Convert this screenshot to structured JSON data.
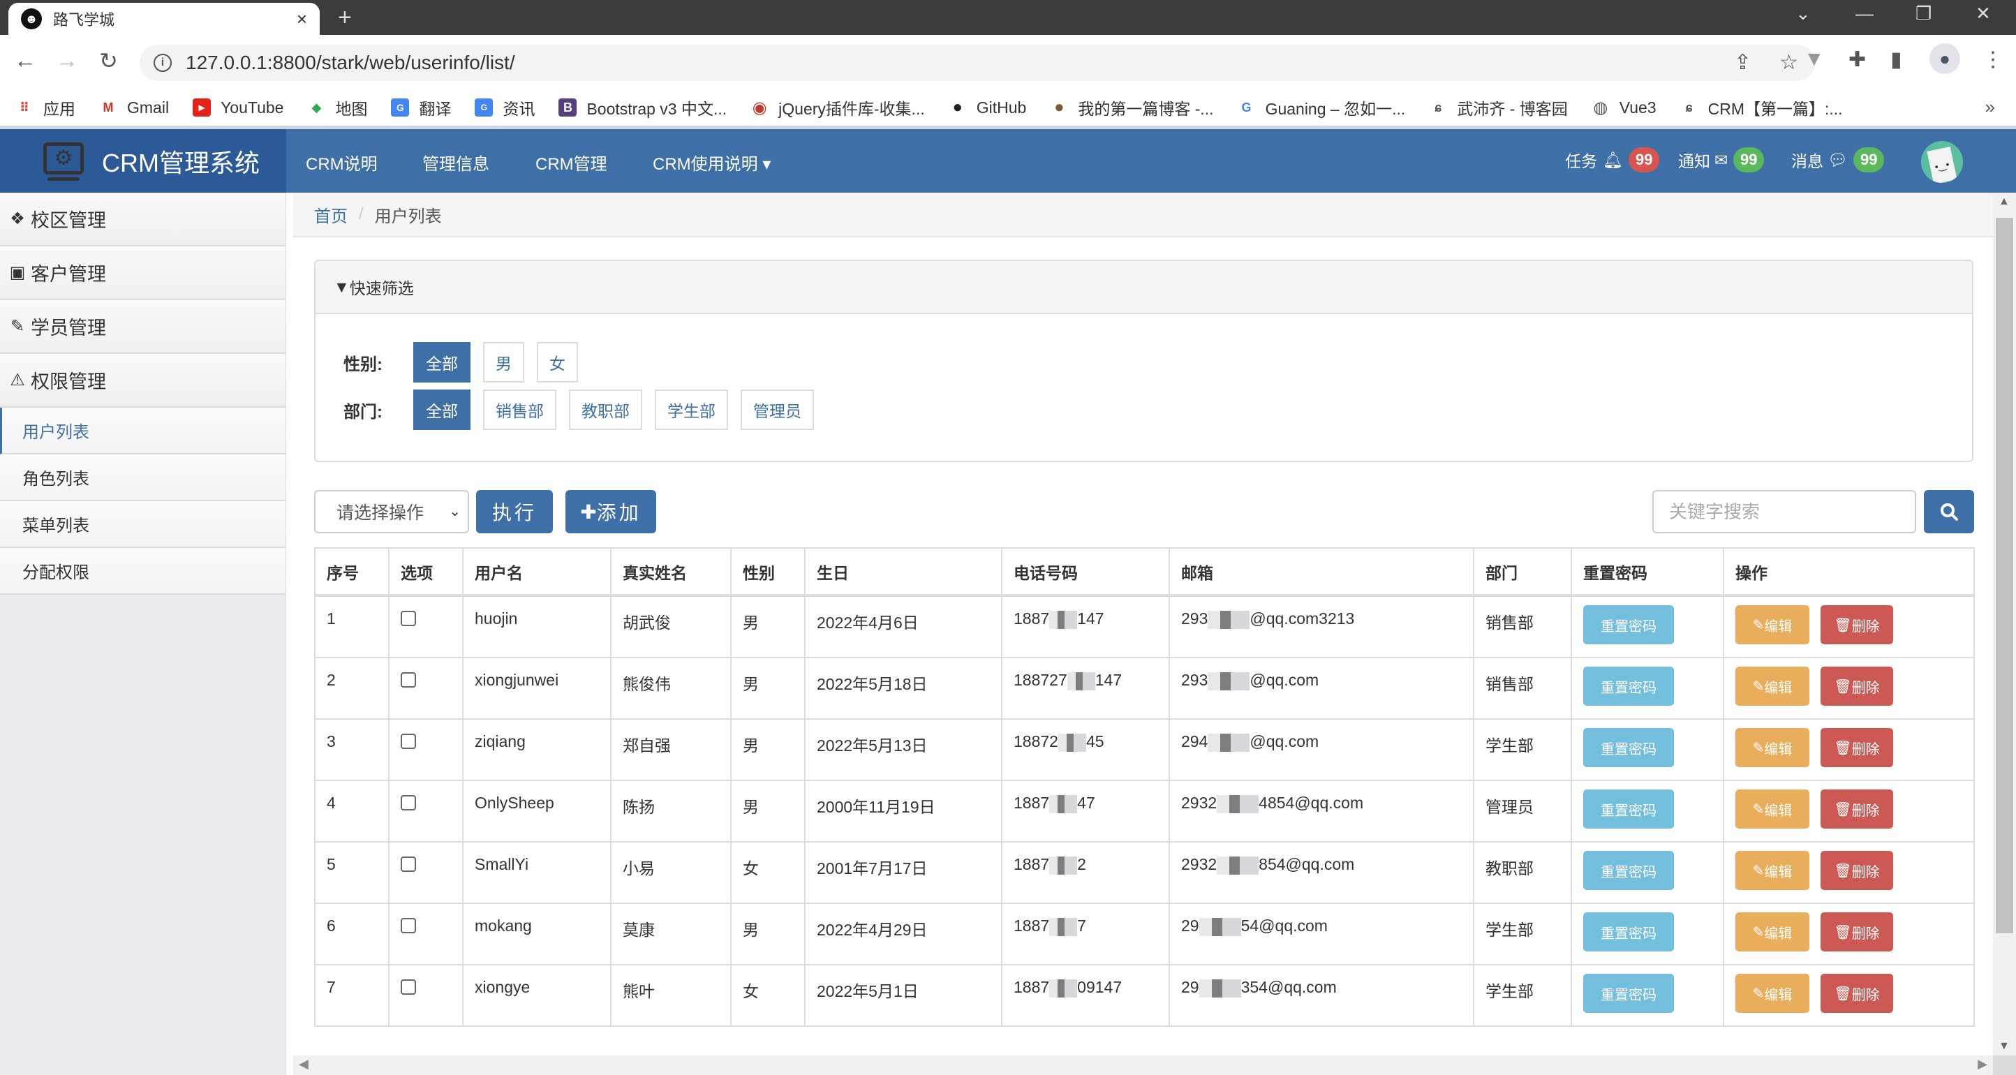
{
  "browser": {
    "tab_title": "路飞学城",
    "tab_close": "×",
    "new_tab": "+",
    "url": "127.0.0.1:8800/stark/web/userinfo/list/",
    "window_controls": {
      "tabsearch": "⌄",
      "minimize": "—",
      "restore": "❐",
      "close": "✕"
    },
    "bookmarks": [
      {
        "label": "应用",
        "icon": "apps-grid-icon"
      },
      {
        "label": "Gmail",
        "icon": "gmail-icon"
      },
      {
        "label": "YouTube",
        "icon": "youtube-icon"
      },
      {
        "label": "地图",
        "icon": "maps-icon"
      },
      {
        "label": "翻译",
        "icon": "translate-icon"
      },
      {
        "label": "资讯",
        "icon": "news-icon"
      },
      {
        "label": "Bootstrap v3 中文...",
        "icon": "bootstrap-icon"
      },
      {
        "label": "jQuery插件库-收集...",
        "icon": "jquery-icon"
      },
      {
        "label": "GitHub",
        "icon": "github-icon"
      },
      {
        "label": "我的第一篇博客 -...",
        "icon": "blog-icon"
      },
      {
        "label": "Guaning – 忽如一...",
        "icon": "google-icon"
      },
      {
        "label": "武沛齐 - 博客园",
        "icon": "cnblogs-icon"
      },
      {
        "label": "Vue3",
        "icon": "globe-icon"
      },
      {
        "label": "CRM【第一篇】:...",
        "icon": "cnblogs-icon"
      }
    ],
    "bookmarks_more": "»"
  },
  "navbar": {
    "brand": "CRM管理系统",
    "links": [
      "CRM说明",
      "管理信息",
      "CRM管理",
      "CRM使用说明"
    ],
    "dropdown_caret": "▾",
    "tasks": {
      "label": "任务",
      "count": "99",
      "color": "#d9534f"
    },
    "notices": {
      "label": "通知",
      "count": "99",
      "color": "#5cb85c"
    },
    "messages": {
      "label": "消息",
      "count": "99",
      "color": "#5cb85c"
    }
  },
  "sidebar": {
    "groups": [
      {
        "label": "校区管理",
        "icon": "cubes-icon"
      },
      {
        "label": "客户管理",
        "icon": "address-book-icon"
      },
      {
        "label": "学员管理",
        "icon": "paintbrush-icon"
      },
      {
        "label": "权限管理",
        "icon": "warning-icon"
      }
    ],
    "items": [
      {
        "label": "用户列表",
        "active": true
      },
      {
        "label": "角色列表",
        "active": false
      },
      {
        "label": "菜单列表",
        "active": false
      },
      {
        "label": "分配权限",
        "active": false
      }
    ]
  },
  "breadcrumb": {
    "home": "首页",
    "separator": "/",
    "current": "用户列表"
  },
  "filter": {
    "title": "快速筛选",
    "gender": {
      "label": "性别:",
      "options": [
        "全部",
        "男",
        "女"
      ],
      "selected": "全部"
    },
    "department": {
      "label": "部门:",
      "options": [
        "全部",
        "销售部",
        "教职部",
        "学生部",
        "管理员"
      ],
      "selected": "全部"
    }
  },
  "actions": {
    "select_value": "请选择操作",
    "execute_label": "执行",
    "add_label": "添加",
    "search_placeholder": "关键字搜索"
  },
  "table": {
    "columns": [
      "序号",
      "选项",
      "用户名",
      "真实姓名",
      "性别",
      "生日",
      "电话号码",
      "邮箱",
      "部门",
      "重置密码",
      "操作"
    ],
    "reset_label": "重置密码",
    "edit_label": "编辑",
    "delete_label": "删除",
    "rows": [
      {
        "id": "1",
        "username": "huojin",
        "name": "胡武俊",
        "gender": "男",
        "birthday": "2022年4月6日",
        "phone_a": "1887",
        "phone_b": "147",
        "email_a": "293",
        "email_b": "@qq.com3213",
        "dept": "销售部"
      },
      {
        "id": "2",
        "username": "xiongjunwei",
        "name": "熊俊伟",
        "gender": "男",
        "birthday": "2022年5月18日",
        "phone_a": "188727",
        "phone_b": "147",
        "email_a": "293",
        "email_b": "@qq.com",
        "dept": "销售部"
      },
      {
        "id": "3",
        "username": "ziqiang",
        "name": "郑自强",
        "gender": "男",
        "birthday": "2022年5月13日",
        "phone_a": "18872",
        "phone_b": "45",
        "email_a": "294",
        "email_b": "@qq.com",
        "dept": "学生部"
      },
      {
        "id": "4",
        "username": "OnlySheep",
        "name": "陈扬",
        "gender": "男",
        "birthday": "2000年11月19日",
        "phone_a": "1887",
        "phone_b": "47",
        "email_a": "2932",
        "email_b": "4854@qq.com",
        "dept": "管理员"
      },
      {
        "id": "5",
        "username": "SmallYi",
        "name": "小易",
        "gender": "女",
        "birthday": "2001年7月17日",
        "phone_a": "1887",
        "phone_b": "2",
        "email_a": "2932",
        "email_b": "854@qq.com",
        "dept": "教职部"
      },
      {
        "id": "6",
        "username": "mokang",
        "name": "莫康",
        "gender": "男",
        "birthday": "2022年4月29日",
        "phone_a": "1887",
        "phone_b": "7",
        "email_a": "29",
        "email_b": "54@qq.com",
        "dept": "学生部"
      },
      {
        "id": "7",
        "username": "xiongye",
        "name": "熊叶",
        "gender": "女",
        "birthday": "2022年5月1日",
        "phone_a": "1887",
        "phone_b": "09147",
        "email_a": "29",
        "email_b": "354@qq.com",
        "dept": "学生部"
      }
    ]
  }
}
